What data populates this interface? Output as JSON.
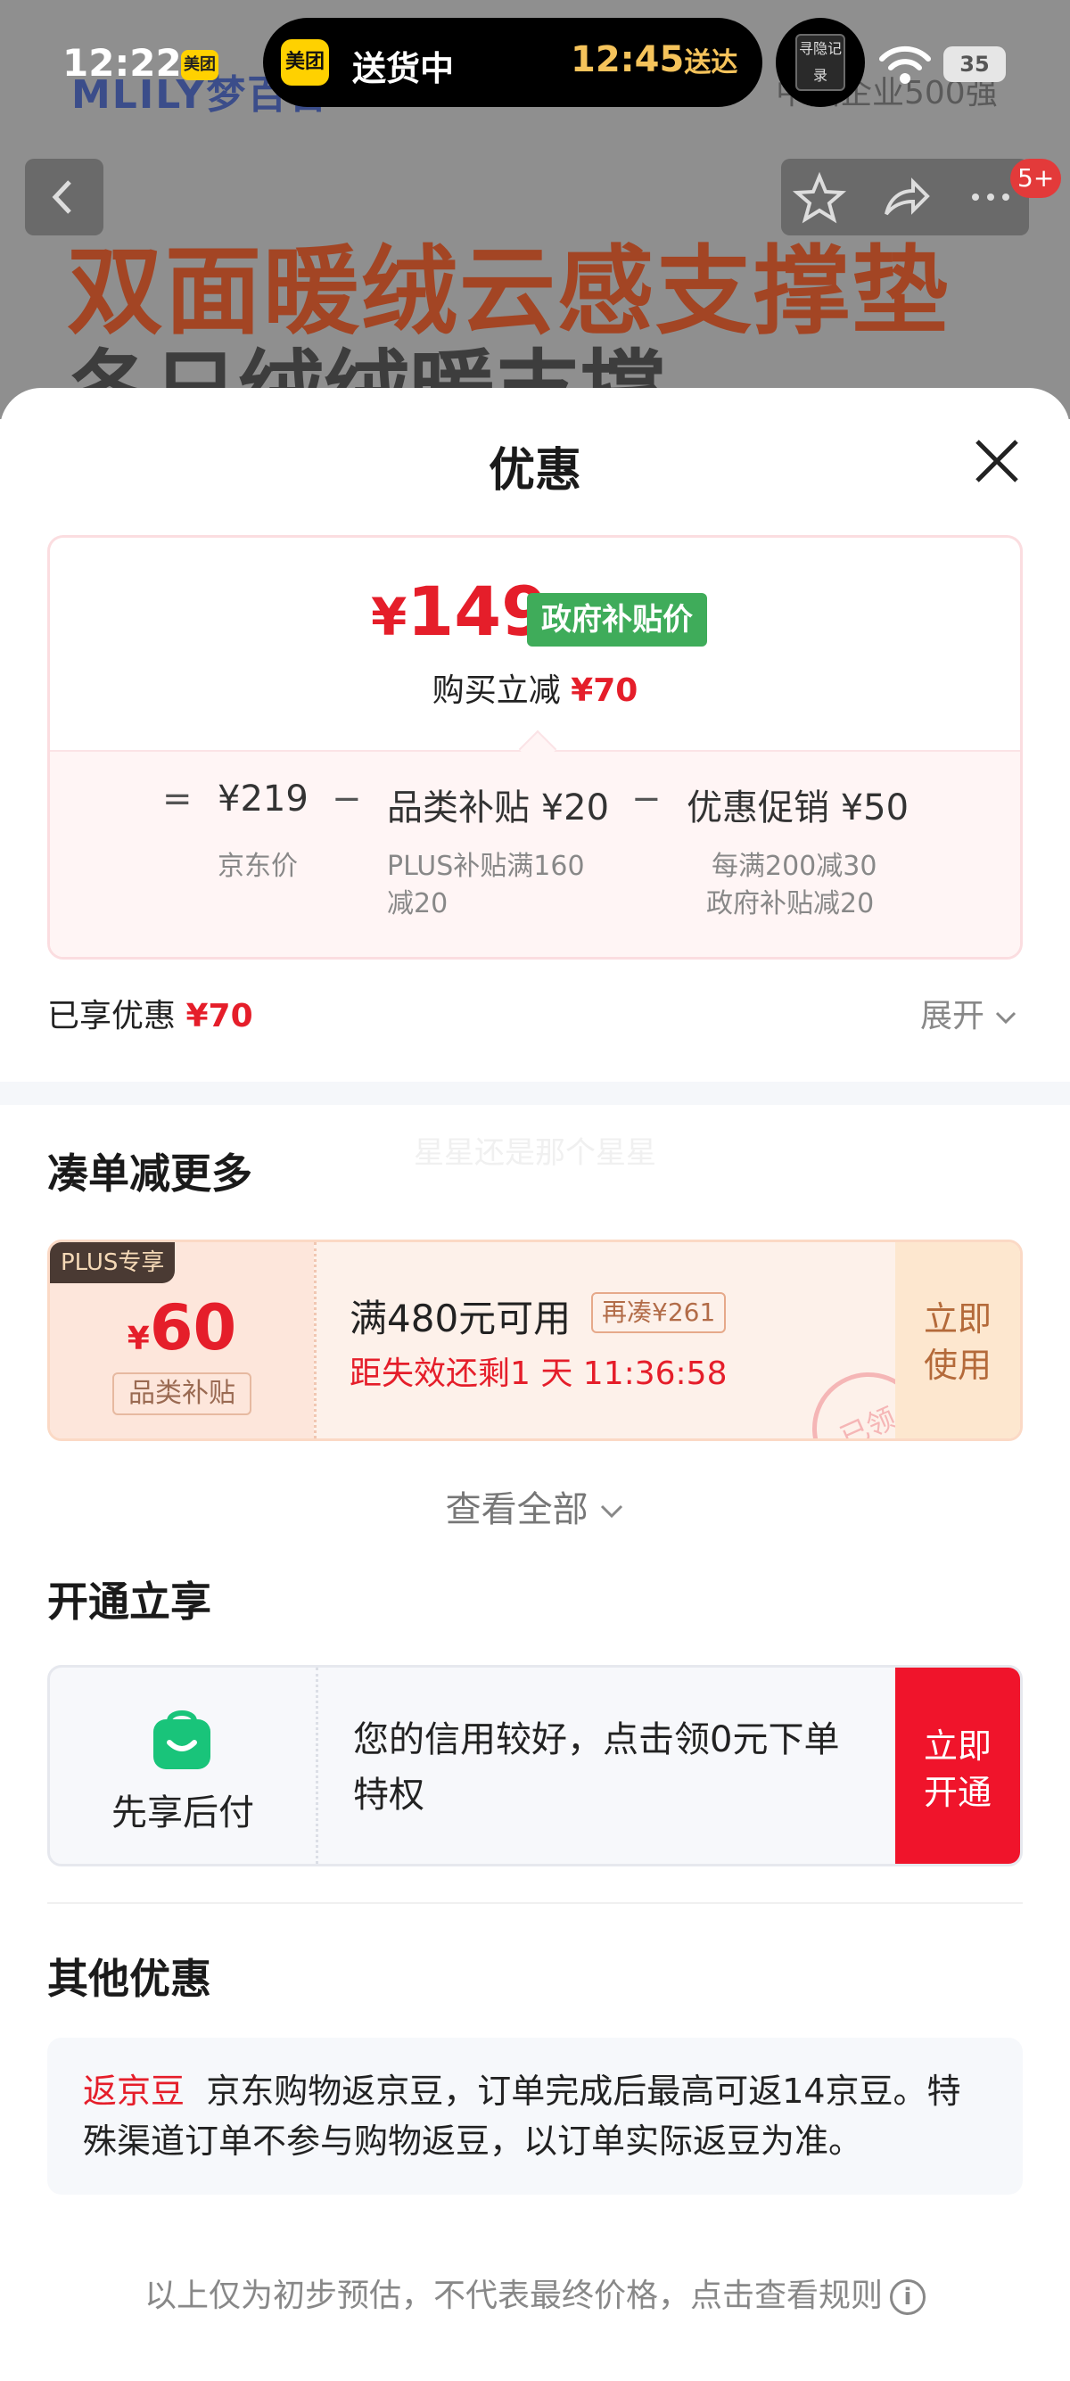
{
  "status_bar": {
    "time": "12:22",
    "small_app_badge": "美团",
    "island_app": "美团",
    "island_status": "送货中",
    "island_eta": "12:45",
    "island_eta_suffix": "送达",
    "live_activity": "寻隐记录",
    "battery": "35"
  },
  "background": {
    "brand": "MLILY梦百合",
    "tagline": "中国企业500强",
    "headline_1": "双面暖绒云感支撑垫",
    "headline_2": "冬日绒绒暖支撑"
  },
  "top_bar": {
    "badge": "5+"
  },
  "sheet": {
    "title": "优惠",
    "price_card": {
      "price_symbol": "¥",
      "price": "149",
      "price_tag": "政府补贴价",
      "buy_reduce_label": "购买立减",
      "buy_reduce_value": "¥70",
      "formula": [
        {
          "op": "=",
          "value": "¥219",
          "sub": "京东价"
        },
        {
          "op": "−",
          "value": "品类补贴 ¥20",
          "sub": "PLUS补贴满160减20"
        },
        {
          "op": "−",
          "value": "优惠促销 ¥50",
          "sub_lines": [
            "每满200减30",
            "政府补贴减20"
          ]
        }
      ]
    },
    "enjoyed_label": "已享优惠",
    "enjoyed_value": "¥70",
    "expand_label": "展开",
    "watermark": "星星还是那个星星",
    "section_more": "凑单减更多",
    "coupon": {
      "tag": "PLUS专享",
      "yen": "¥",
      "amount": "60",
      "type": "品类补贴",
      "condition": "满480元可用",
      "add_more": "再凑¥261",
      "expire": "距失效还剩1 天 11:36:58",
      "stamp": "已领",
      "button_line1": "立即",
      "button_line2": "使用"
    },
    "see_all": "查看全部",
    "section_open": "开通立享",
    "pay_later": {
      "name": "先享后付",
      "text": "您的信用较好，点击领0元下单特权",
      "button_line1": "立即",
      "button_line2": "开通"
    },
    "section_other": "其他优惠",
    "jingdou": {
      "label": "返京豆",
      "text": "京东购物返京豆，订单完成后最高可返14京豆。特殊渠道订单不参与购物返豆，以订单实际返豆为准。"
    },
    "footer": "以上仅为初步预估，不代表最终价格，点击查看规则"
  },
  "colors": {
    "accent_red": "#e51e2a",
    "gov_green": "#3fac5a",
    "pay_red": "#f0142b"
  }
}
